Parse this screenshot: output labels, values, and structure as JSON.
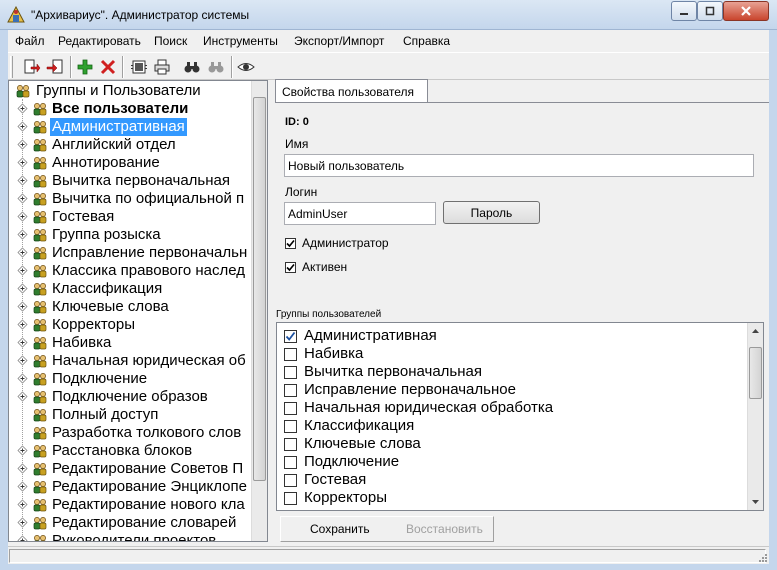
{
  "window": {
    "title": "\"Архивариус\". Администратор системы"
  },
  "menu": [
    "Файл",
    "Редактировать",
    "Поиск",
    "Инструменты",
    "Экспорт/Импорт",
    "Справка"
  ],
  "toolbar_icons": [
    "export-icon",
    "import-icon",
    "add-icon",
    "delete-icon",
    "properties-icon",
    "print-icon",
    "find-icon",
    "find-next-icon",
    "view-icon"
  ],
  "tree": {
    "root_label": "Группы и Пользователи",
    "items": [
      {
        "label": "Все пользователи",
        "bold": true
      },
      {
        "label": "Административная",
        "selected": true
      },
      {
        "label": "Английский отдел"
      },
      {
        "label": "Аннотирование"
      },
      {
        "label": "Вычитка первоначальная"
      },
      {
        "label": "Вычитка по официальной п"
      },
      {
        "label": "Гостевая"
      },
      {
        "label": "Группа розыска"
      },
      {
        "label": "Исправление первоначальн"
      },
      {
        "label": "Классика правового наслед"
      },
      {
        "label": "Классификация"
      },
      {
        "label": "Ключевые слова"
      },
      {
        "label": "Корректоры"
      },
      {
        "label": "Набивка"
      },
      {
        "label": "Начальная юридическая об"
      },
      {
        "label": "Подключение"
      },
      {
        "label": "Подключение образов"
      },
      {
        "label": "Полный доступ",
        "no_expander": true
      },
      {
        "label": "Разработка толкового слов",
        "no_expander": true
      },
      {
        "label": "Расстановка блоков"
      },
      {
        "label": "Редактирование Советов П"
      },
      {
        "label": "Редактирование Энциклопе"
      },
      {
        "label": "Редактирование нового кла"
      },
      {
        "label": "Редактирование словарей"
      },
      {
        "label": "Руководители проектов"
      }
    ]
  },
  "properties": {
    "tab_label": "Свойства пользователя",
    "id_label": "ID: 0",
    "name_label": "Имя",
    "name_value": "Новый пользователь",
    "login_label": "Логин",
    "login_value": "AdminUser",
    "password_button": "Пароль",
    "admin_label": "Администратор",
    "admin_checked": true,
    "active_label": "Активен",
    "active_checked": true
  },
  "groups": {
    "label": "Группы пользователей",
    "items": [
      {
        "label": "Административная",
        "checked": true
      },
      {
        "label": "Набивка",
        "checked": false
      },
      {
        "label": "Вычитка первоначальная",
        "checked": false
      },
      {
        "label": "Исправление первоначальное",
        "checked": false
      },
      {
        "label": "Начальная юридическая обработка",
        "checked": false
      },
      {
        "label": "Классификация",
        "checked": false
      },
      {
        "label": "Ключевые слова",
        "checked": false
      },
      {
        "label": "Подключение",
        "checked": false
      },
      {
        "label": "Гостевая",
        "checked": false
      },
      {
        "label": "Корректоры",
        "checked": false
      }
    ]
  },
  "actions": {
    "save": "Сохранить",
    "restore": "Восстановить"
  },
  "colors": {
    "selection": "#3399ff",
    "disabled_text": "#a0a0a0"
  }
}
